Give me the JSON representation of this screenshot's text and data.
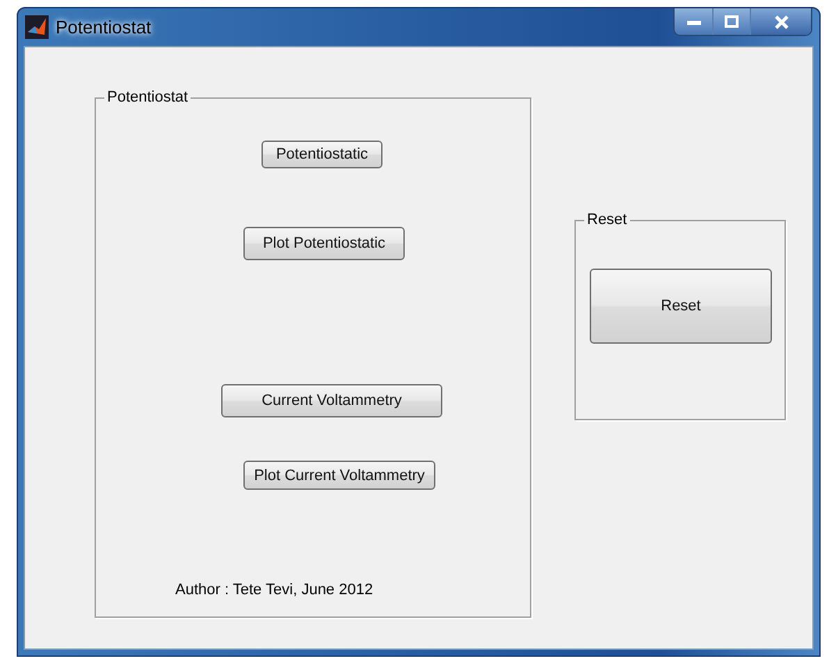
{
  "window": {
    "title": "Potentiostat"
  },
  "panels": [
    {
      "title": "Potentiostat",
      "buttons": [
        "Potentiostatic",
        "Plot Potentiostatic",
        "Current Voltammetry",
        "Plot Current Voltammetry"
      ],
      "note": "Author : Tete Tevi, June 2012"
    },
    {
      "title": "Reset",
      "buttons": [
        "Reset"
      ]
    }
  ]
}
